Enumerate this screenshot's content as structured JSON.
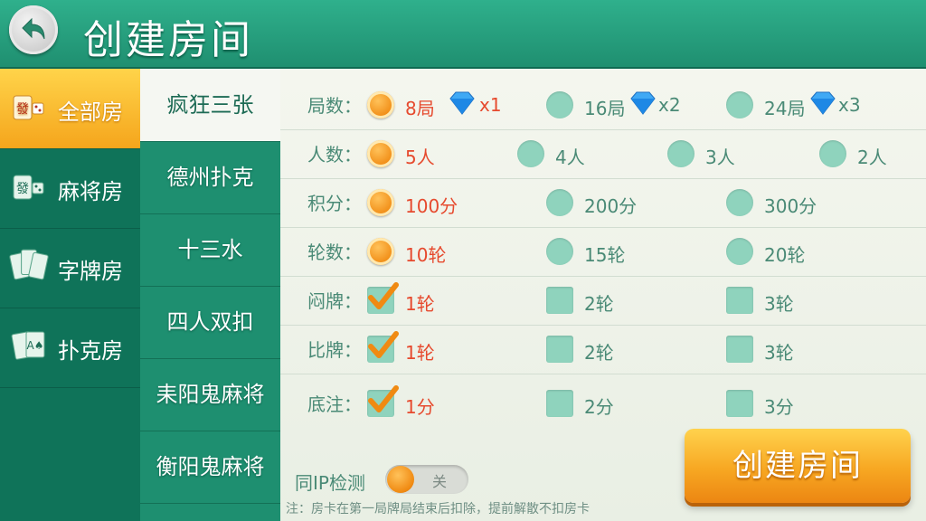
{
  "header": {
    "title": "创建房间",
    "back_icon": "back-arrow-icon"
  },
  "sidebar": {
    "items": [
      {
        "label": "全部房",
        "icon": "mahjong-tile-icon",
        "active": true
      },
      {
        "label": "麻将房",
        "icon": "mahjong-tile-icon",
        "active": false
      },
      {
        "label": "字牌房",
        "icon": "zipai-cards-icon",
        "active": false
      },
      {
        "label": "扑克房",
        "icon": "poker-cards-icon",
        "active": false
      }
    ]
  },
  "games": {
    "items": [
      {
        "label": "疯狂三张",
        "active": true
      },
      {
        "label": "德州扑克",
        "active": false
      },
      {
        "label": "十三水",
        "active": false
      },
      {
        "label": "四人双扣",
        "active": false
      },
      {
        "label": "耒阳鬼麻将",
        "active": false
      },
      {
        "label": "衡阳鬼麻将",
        "active": false
      }
    ]
  },
  "options": {
    "rounds": {
      "label": "局数：",
      "choices": [
        {
          "text": "8局",
          "mult": "x1",
          "selected": true
        },
        {
          "text": "16局",
          "mult": "x2",
          "selected": false
        },
        {
          "text": "24局",
          "mult": "x3",
          "selected": false
        }
      ]
    },
    "players": {
      "label": "人数：",
      "choices": [
        {
          "text": "5人",
          "selected": true
        },
        {
          "text": "4人",
          "selected": false
        },
        {
          "text": "3人",
          "selected": false
        },
        {
          "text": "2人",
          "selected": false
        }
      ]
    },
    "points": {
      "label": "积分：",
      "choices": [
        {
          "text": "100分",
          "selected": true
        },
        {
          "text": "200分",
          "selected": false
        },
        {
          "text": "300分",
          "selected": false
        }
      ]
    },
    "turns": {
      "label": "轮数：",
      "choices": [
        {
          "text": "10轮",
          "selected": true
        },
        {
          "text": "15轮",
          "selected": false
        },
        {
          "text": "20轮",
          "selected": false
        }
      ]
    },
    "blind": {
      "label": "闷牌：",
      "choices": [
        {
          "text": "1轮",
          "checked": true
        },
        {
          "text": "2轮",
          "checked": false
        },
        {
          "text": "3轮",
          "checked": false
        }
      ]
    },
    "compare": {
      "label": "比牌：",
      "choices": [
        {
          "text": "1轮",
          "checked": true
        },
        {
          "text": "2轮",
          "checked": false
        },
        {
          "text": "3轮",
          "checked": false
        }
      ]
    },
    "ante": {
      "label": "底注：",
      "choices": [
        {
          "text": "1分",
          "checked": true
        },
        {
          "text": "2分",
          "checked": false
        },
        {
          "text": "3分",
          "checked": false
        }
      ]
    }
  },
  "ip_check": {
    "label": "同IP检测",
    "state": "关"
  },
  "note": "注：房卡在第一局牌局结束后扣除，提前解散不扣房卡",
  "create_button": "创建房间",
  "colors": {
    "accent_orange": "#f08a12",
    "selected_text": "#e64a2e",
    "header_green": "#2fb08c",
    "option_text": "#4a8a76"
  }
}
